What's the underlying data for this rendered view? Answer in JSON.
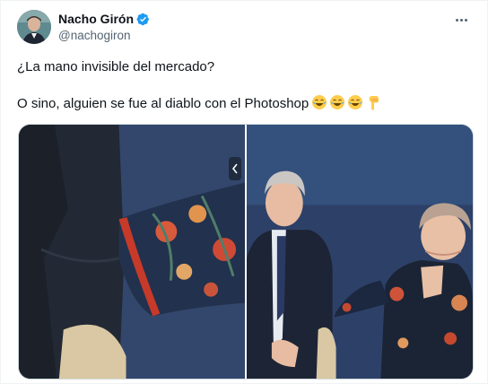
{
  "author": {
    "display_name": "Nacho Girón",
    "handle": "@nachogiron",
    "verified": true,
    "avatar_icon": "profile-photo"
  },
  "menu": {
    "icon": "more-horizontal-icon"
  },
  "tweet": {
    "line1": "¿La mano invisible del mercado?",
    "line2": "O sino, alguien se fue al diablo con el Photoshop",
    "emojis": [
      "face-with-tears-of-joy",
      "face-with-tears-of-joy",
      "face-with-tears-of-joy",
      "backhand-index-pointing-down"
    ]
  },
  "media": {
    "photos": [
      {
        "name": "cropped-sleeve-photo"
      },
      {
        "name": "two-people-seated-photo"
      }
    ],
    "nav_icon": "chevron-left-icon"
  },
  "colors": {
    "text_primary": "#0f1419",
    "text_secondary": "#536471",
    "verified_blue": "#1d9bf0",
    "media_background": "#2b3e63"
  }
}
